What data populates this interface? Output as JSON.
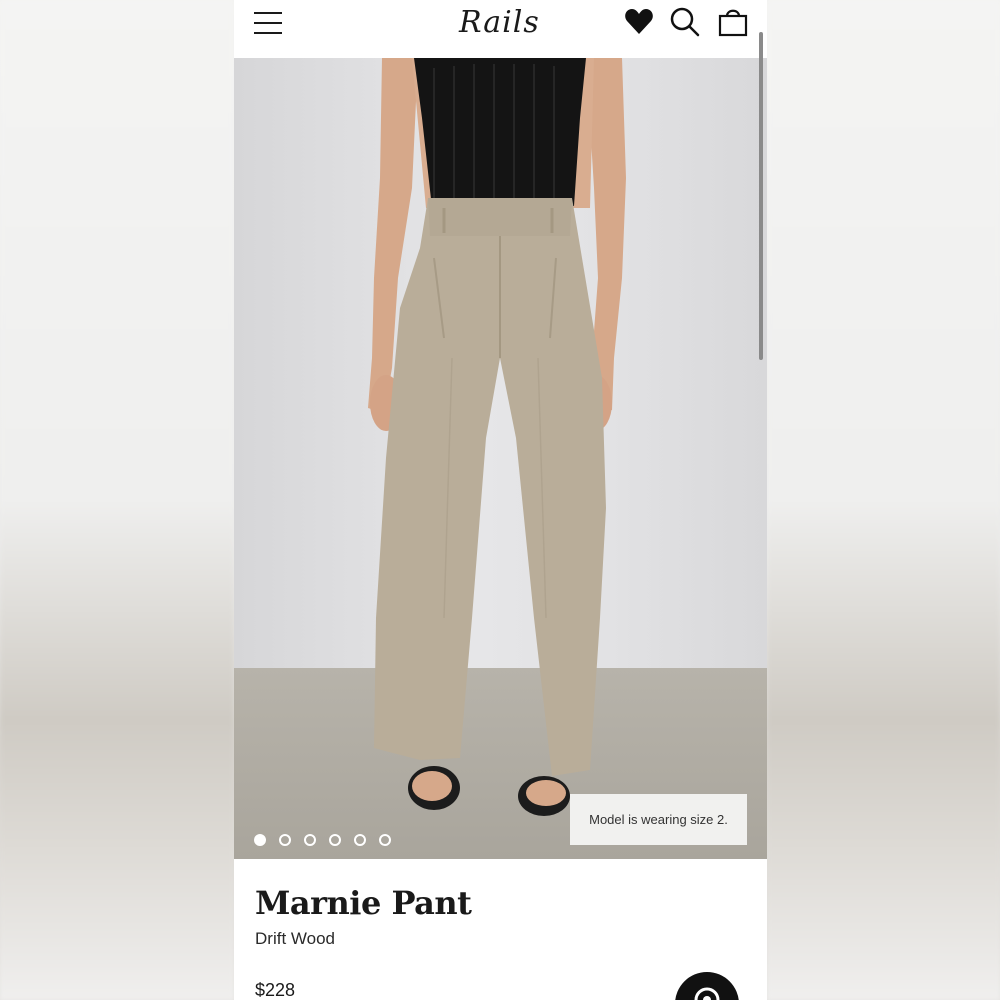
{
  "header": {
    "logo_text": "Rails",
    "icons": [
      "menu-icon",
      "heart-icon",
      "search-icon",
      "bag-icon"
    ]
  },
  "gallery": {
    "image_count": 6,
    "active_index": 1,
    "size_note": "Model is wearing size 2."
  },
  "product": {
    "name": "Marnie Pant",
    "color": "Drift Wood",
    "price": "$228"
  },
  "chat": {
    "icon": "chat-icon"
  },
  "colors": {
    "accent": "#111111",
    "pant": "#b9ad99",
    "top": "#141414"
  }
}
